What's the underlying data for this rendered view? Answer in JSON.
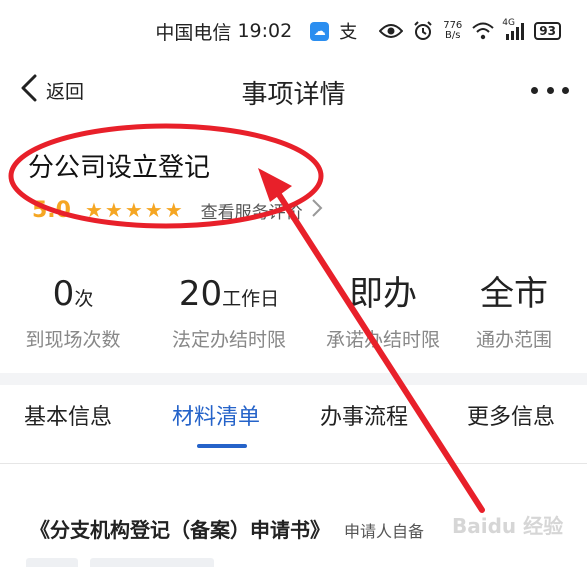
{
  "status_bar": {
    "carrier": "中国电信",
    "time": "19:02",
    "alipay_glyph": "支",
    "net_speed_value": "776",
    "net_speed_unit": "B/s",
    "signal_label": "4G",
    "battery": "93"
  },
  "nav": {
    "back_label": "返回",
    "title": "事项详情"
  },
  "item": {
    "title": "分公司设立登记",
    "rating_score": "5.0",
    "stars": 5,
    "view_reviews_label": "查看服务评价"
  },
  "stats": [
    {
      "value": "0",
      "unit": "次",
      "label": "到现场次数"
    },
    {
      "value": "20",
      "unit": "工作日",
      "label": "法定办结时限"
    },
    {
      "value": "即办",
      "unit": "",
      "label": "承诺办结时限"
    },
    {
      "value": "全市",
      "unit": "",
      "label": "通办范围"
    }
  ],
  "tabs": [
    {
      "label": "基本信息",
      "active": false
    },
    {
      "label": "材料清单",
      "active": true
    },
    {
      "label": "办事流程",
      "active": false
    },
    {
      "label": "更多信息",
      "active": false
    }
  ],
  "material": {
    "name": "《分支机构登记（备案）申请书》",
    "note": "申请人自备"
  },
  "watermark": "Baidu 经验",
  "colors": {
    "accent_blue": "#2563c9",
    "star_orange": "#f5a623",
    "annotation_red": "#e8202a"
  },
  "icons": {
    "back": "chevron-left-icon",
    "more": "more-dots-icon",
    "star": "star-icon",
    "chevron": "chevron-right-icon"
  }
}
